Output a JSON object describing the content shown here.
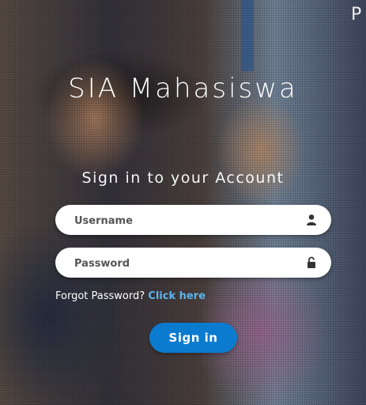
{
  "app": {
    "title": "SIA Mahasiswa",
    "corner_glyph": "P"
  },
  "login": {
    "heading": "Sign in to your Account",
    "username_placeholder": "Username",
    "username_value": "",
    "username_icon": "user-icon",
    "password_placeholder": "Password",
    "password_value": "",
    "password_icon": "lock-icon",
    "forgot_text": "Forgot Password?",
    "forgot_link": "Click here",
    "submit_label": "Sign in"
  },
  "colors": {
    "button": "#0b7bd0",
    "link": "#5bb4ef",
    "text": "#ffffff"
  }
}
